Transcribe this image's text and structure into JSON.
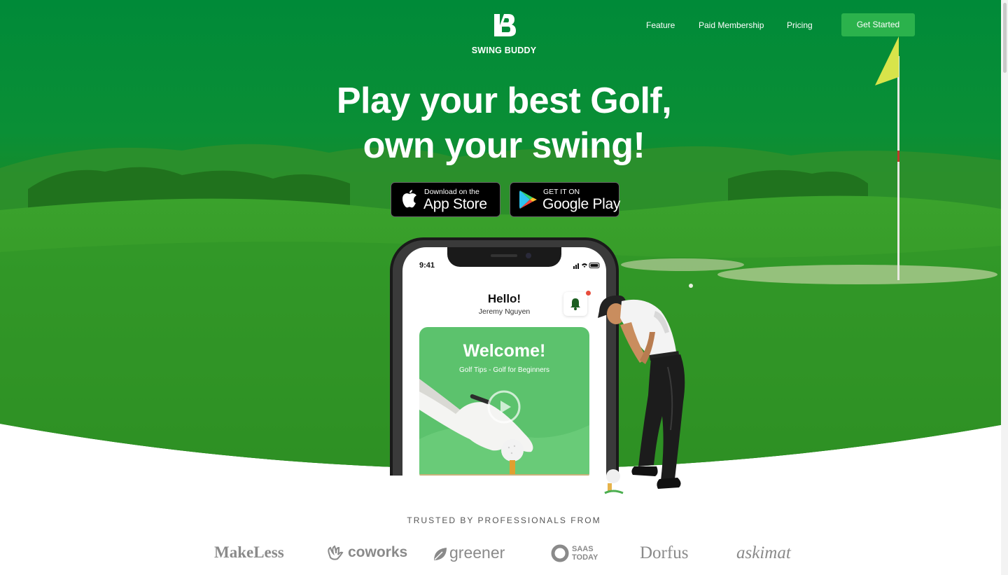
{
  "brand": {
    "name": "SWING BUDDY"
  },
  "nav": {
    "links": [
      "Feature",
      "Paid Membership",
      "Pricing"
    ],
    "cta": "Get Started"
  },
  "hero": {
    "headline_line1": "Play your best Golf,",
    "headline_line2": "own your swing!",
    "app_store": {
      "small": "Download on the",
      "big": "App Store",
      "icon": "apple-icon"
    },
    "google_play": {
      "small": "GET IT ON",
      "big": "Google Play",
      "icon": "google-play-icon"
    }
  },
  "phone": {
    "time": "9:41",
    "greeting": "Hello!",
    "username": "Jeremy Nguyen",
    "card_title": "Welcome!",
    "card_subtitle": "Golf Tips - Golf for Beginners"
  },
  "trusted": {
    "label": "TRUSTED BY PROFESSIONALS FROM",
    "logos": [
      "MakeLess",
      "coworks",
      "greener",
      "SAAS",
      "TODAY",
      "Dorfus",
      "askimat"
    ]
  },
  "colors": {
    "hero_green": "#008a38",
    "accent_green": "#2bb24c",
    "card_green": "#5cc26d"
  }
}
